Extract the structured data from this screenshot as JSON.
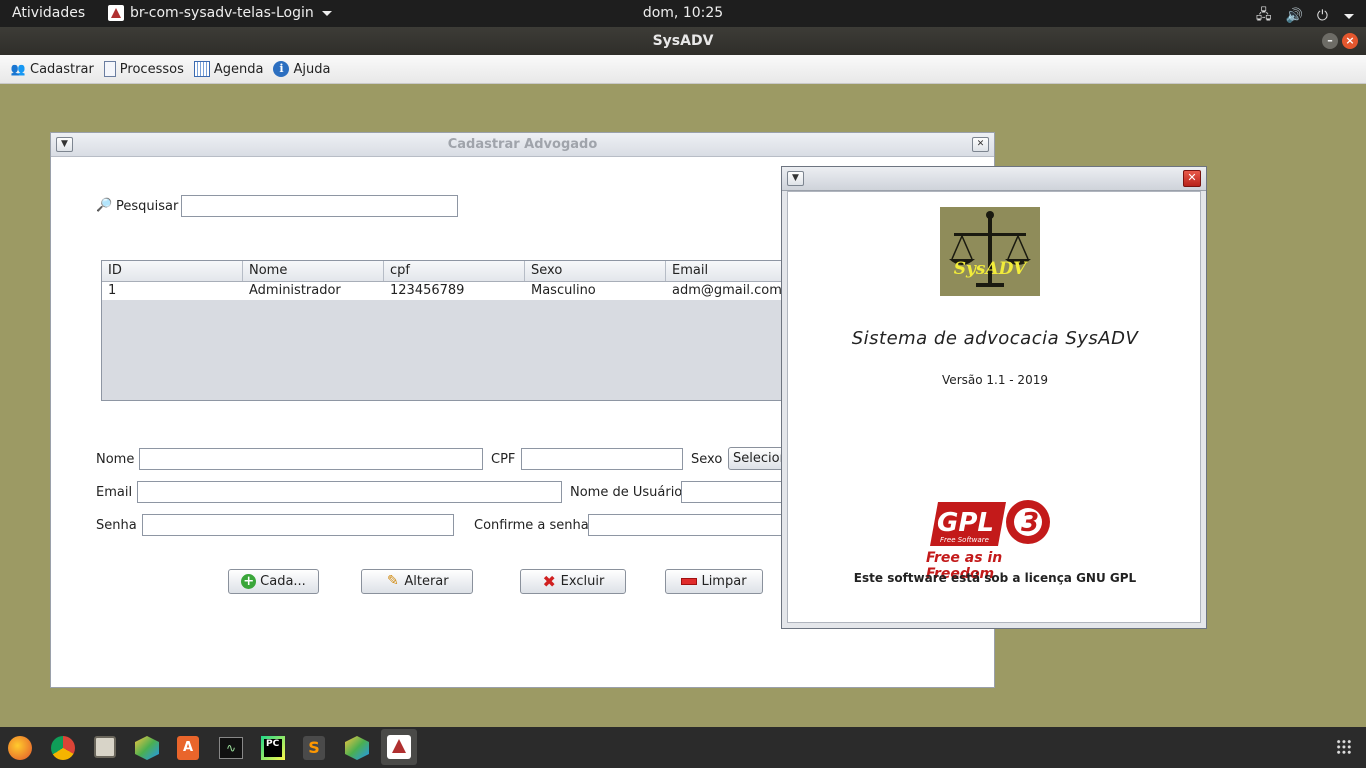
{
  "topbar": {
    "activities": "Atividades",
    "app_menu": "br-com-sysadv-telas-Login",
    "clock": "dom, 10:25"
  },
  "window": {
    "title": "SysADV"
  },
  "menubar": {
    "items": [
      {
        "label": "Cadastrar",
        "icon": "users-icon"
      },
      {
        "label": "Processos",
        "icon": "document-icon"
      },
      {
        "label": "Agenda",
        "icon": "calendar-icon"
      },
      {
        "label": "Ajuda",
        "icon": "info-icon"
      }
    ]
  },
  "cadastro": {
    "title": "Cadastrar Advogado",
    "search_label": "Pesquisar",
    "search_value": "",
    "table": {
      "columns": [
        "ID",
        "Nome",
        "cpf",
        "Sexo",
        "Email"
      ],
      "rows": [
        [
          "1",
          "Administrador",
          "123456789",
          "Masculino",
          "adm@gmail.com"
        ]
      ]
    },
    "form": {
      "nome_label": "Nome",
      "cpf_label": "CPF",
      "sexo_label": "Sexo",
      "sexo_value": "Selecion",
      "email_label": "Email",
      "usuario_label": "Nome de Usuário",
      "senha_label": "Senha",
      "confirma_label": "Confirme a senha"
    },
    "buttons": {
      "cadastrar": "Cada...",
      "alterar": "Alterar",
      "excluir": "Excluir",
      "limpar": "Limpar"
    }
  },
  "about": {
    "logo_text": "SysADV",
    "system_name": "Sistema de advocacia SysADV",
    "version": "Versão 1.1 - 2019",
    "gpl_logo_text": "GPL",
    "gpl_sub": "Free Software",
    "gpl_version": "3",
    "gpl_tagline": "Free as in Freedom",
    "license": "Este software está sob a licença GNU GPL"
  },
  "dock": {
    "apps": [
      "firefox-icon",
      "chrome-icon",
      "files-icon",
      "box-icon",
      "store-icon",
      "monitor-icon",
      "pycharm-icon",
      "sublime-icon",
      "box2-icon",
      "java-icon"
    ]
  }
}
